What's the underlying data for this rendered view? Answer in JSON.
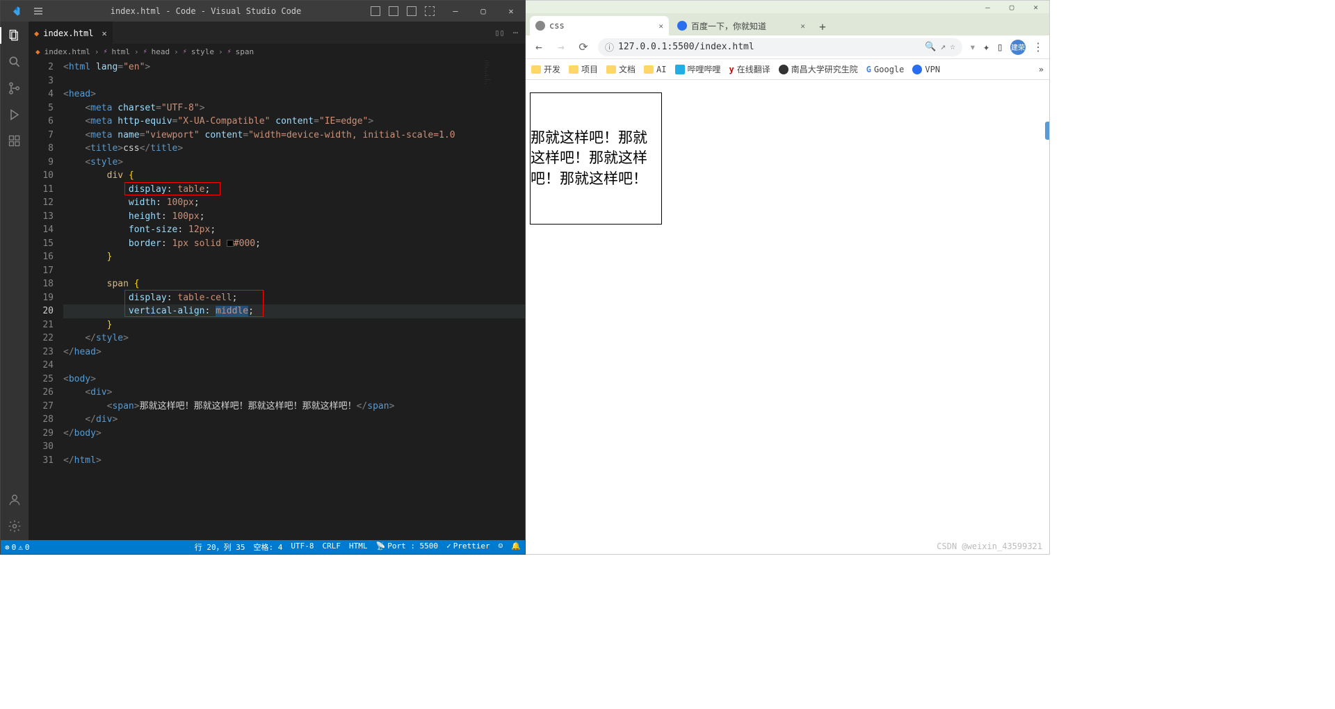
{
  "vscode": {
    "title": "index.html - Code - Visual Studio Code",
    "tab": {
      "name": "index.html"
    },
    "breadcrumb": [
      "index.html",
      "html",
      "head",
      "style",
      "span"
    ],
    "lines": {
      "start": 2,
      "end": 31
    },
    "code": {
      "l2": "<html lang=\"en\">",
      "l4": "<head>",
      "l5": "<meta charset=\"UTF-8\">",
      "l6": "<meta http-equiv=\"X-UA-Compatible\" content=\"IE=edge\">",
      "l7": "<meta name=\"viewport\" content=\"width=device-width, initial-scale=1.0",
      "l8a": "<title>",
      "l8b": "css",
      "l8c": "</title>",
      "l9": "<style>",
      "l10": "div {",
      "l11a": "display",
      "l11b": "table",
      "l12a": "width",
      "l12b": "100px",
      "l13a": "height",
      "l13b": "100px",
      "l14a": "font-size",
      "l14b": "12px",
      "l15a": "border",
      "l15b": "1px",
      "l15c": "solid",
      "l15d": "#000",
      "l18": "span {",
      "l19a": "display",
      "l19b": "table-cell",
      "l20a": "vertical-align",
      "l20b": "middle",
      "l22": "</style>",
      "l23": "</head>",
      "l25": "<body>",
      "l26": "<div>",
      "l27a": "<span>",
      "l27b": "那就这样吧！那就这样吧！那就这样吧！那就这样吧！",
      "l27c": "</span>",
      "l28": "</div>",
      "l29": "</body>",
      "l31": "</html>"
    },
    "status": {
      "errors": "0",
      "warnings": "0",
      "pos": "行 20，列 35",
      "spaces": "空格: 4",
      "encoding": "UTF-8",
      "eol": "CRLF",
      "lang": "HTML",
      "port": "Port : 5500",
      "prettier": "Prettier"
    }
  },
  "chrome": {
    "tabs": [
      {
        "title": "css",
        "favicon": "globe"
      },
      {
        "title": "百度一下，你就知道",
        "favicon": "baidu"
      }
    ],
    "url": "127.0.0.1:5500/index.html",
    "bookmarks": [
      "开发",
      "项目",
      "文档",
      "AI",
      "哔哩哔哩",
      "在线翻译",
      "南昌大学研究生院",
      "Google",
      "VPN"
    ],
    "content": "那就这样吧！那就这样吧！那就这样吧！那就这样吧！",
    "avatar": "建荣",
    "watermark": "CSDN @weixin_43599321"
  }
}
